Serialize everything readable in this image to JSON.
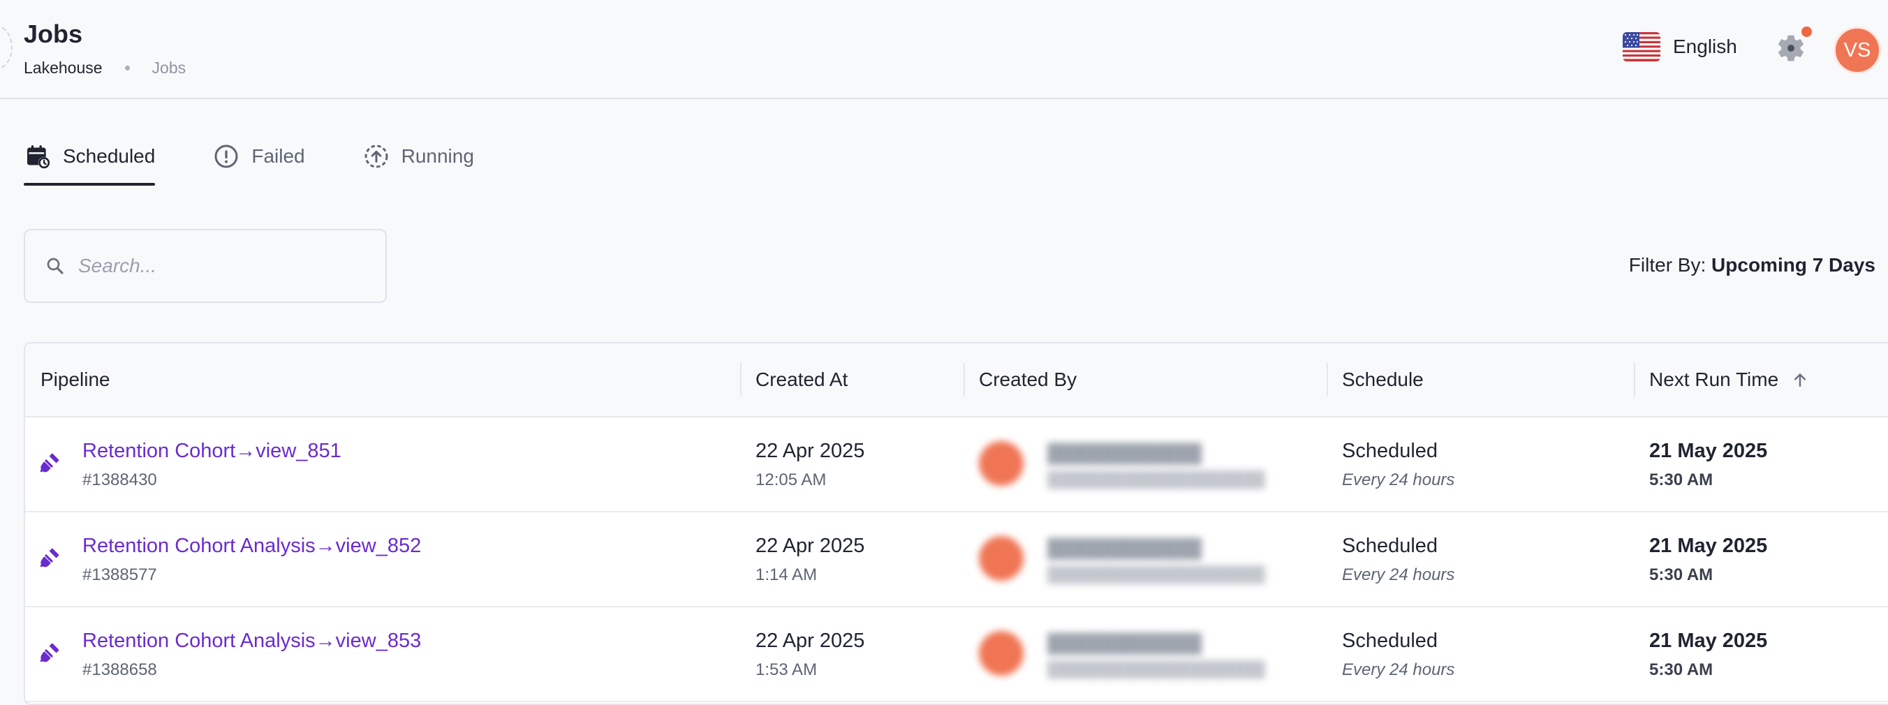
{
  "header": {
    "title": "Jobs",
    "breadcrumb": [
      "Lakehouse",
      "Jobs"
    ],
    "language_label": "English",
    "avatar_initials": "VS",
    "icons": {
      "flag": "us-flag-icon",
      "settings": "gear-icon"
    }
  },
  "tabs": [
    {
      "label": "Scheduled",
      "icon": "calendar-clock-icon",
      "active": true
    },
    {
      "label": "Failed",
      "icon": "alert-circle-icon",
      "active": false
    },
    {
      "label": "Running",
      "icon": "upload-dashed-circle-icon",
      "active": false
    }
  ],
  "search": {
    "placeholder": "Search...",
    "value": ""
  },
  "filter": {
    "label": "Filter By:",
    "value": "Upcoming 7 Days"
  },
  "table": {
    "columns": [
      "Pipeline",
      "Created At",
      "Created By",
      "Schedule",
      "Next Run Time"
    ],
    "sort_icon": "arrow-up-icon",
    "rows": [
      {
        "pipeline_name": "Retention Cohort→view_851",
        "pipeline_id": "#1388430",
        "created_date": "22 Apr 2025",
        "created_time": "12:05 AM",
        "schedule_status": "Scheduled",
        "schedule_interval": "Every 24 hours",
        "next_run_date": "21 May 2025",
        "next_run_time": "5:30 AM"
      },
      {
        "pipeline_name": "Retention Cohort Analysis→view_852",
        "pipeline_id": "#1388577",
        "created_date": "22 Apr 2025",
        "created_time": "1:14 AM",
        "schedule_status": "Scheduled",
        "schedule_interval": "Every 24 hours",
        "next_run_date": "21 May 2025",
        "next_run_time": "5:30 AM"
      },
      {
        "pipeline_name": "Retention Cohort Analysis→view_853",
        "pipeline_id": "#1388658",
        "created_date": "22 Apr 2025",
        "created_time": "1:53 AM",
        "schedule_status": "Scheduled",
        "schedule_interval": "Every 24 hours",
        "next_run_date": "21 May 2025",
        "next_run_time": "5:30 AM"
      }
    ]
  },
  "colors": {
    "accent_link": "#6a2bd0",
    "avatar": "#f07554",
    "notification": "#f0663f",
    "text": "#1f2430"
  }
}
